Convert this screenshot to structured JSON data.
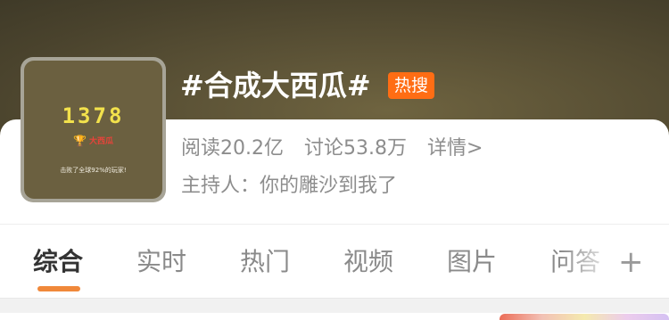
{
  "topic": {
    "title": "#合成大西瓜#",
    "badge": "热搜",
    "thumbnail": {
      "score": "1378",
      "trophy_text": "大西瓜",
      "caption": "击败了全球92%的玩家!"
    },
    "stats": {
      "reads": "阅读20.2亿",
      "discussions": "讨论53.8万",
      "detail": "详情>"
    },
    "host": "主持人：你的雕沙到我了"
  },
  "tabs": [
    {
      "label": "综合",
      "active": true
    },
    {
      "label": "实时",
      "active": false
    },
    {
      "label": "热门",
      "active": false
    },
    {
      "label": "视频",
      "active": false
    },
    {
      "label": "图片",
      "active": false
    },
    {
      "label": "问答",
      "active": false
    }
  ],
  "icons": {
    "add_tab": "plus-icon",
    "trophy": "trophy-icon"
  },
  "colors": {
    "header_bg": "#5b5236",
    "badge_bg": "#ff6d14",
    "tab_indicator": "#f0883a",
    "score_yellow": "#f2e14c"
  }
}
